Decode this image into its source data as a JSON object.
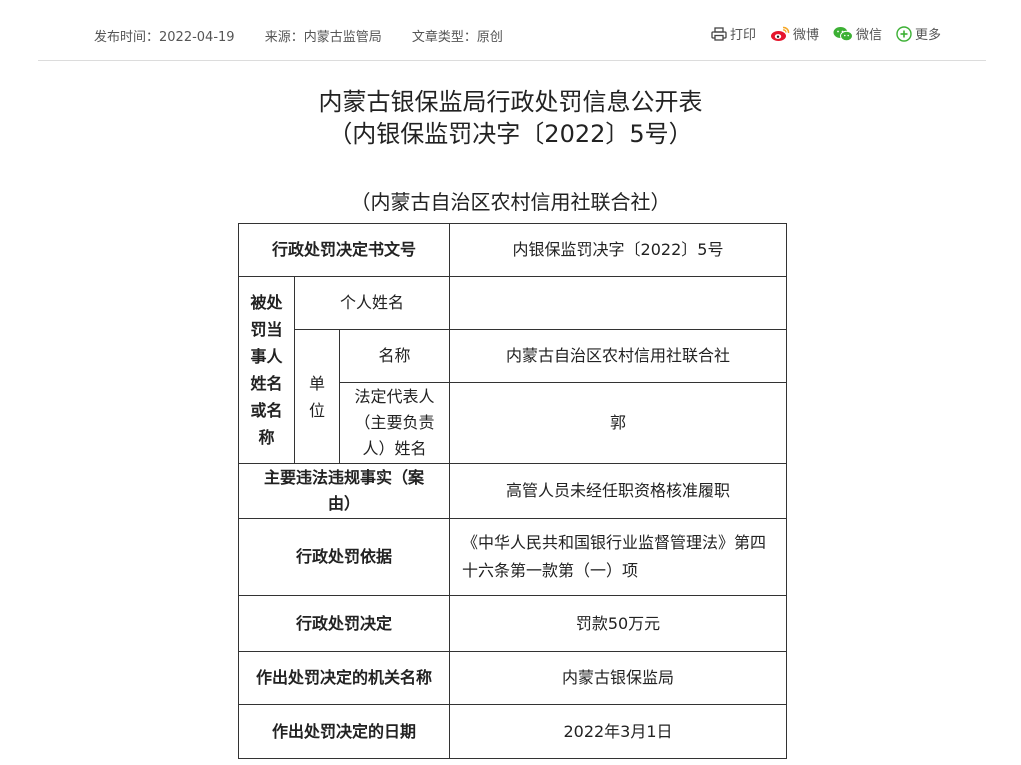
{
  "meta": {
    "publish_time": "发布时间：2022-04-19",
    "source": "来源：内蒙古监管局",
    "article_type": "文章类型：原创"
  },
  "share": {
    "print": "打印",
    "weibo": "微博",
    "wechat": "微信",
    "more": "更多"
  },
  "title_line1": "内蒙古银保监局行政处罚信息公开表",
  "title_line2": "（内银保监罚决字〔2022〕5号）",
  "subtitle": "（内蒙古自治区农村信用社联合社）",
  "table": {
    "doc_no_label": "行政处罚决定书文号",
    "doc_no_value": "内银保监罚决字〔2022〕5号",
    "party_label": "被处罚当事人姓名或名称",
    "person_name_label": "个人姓名",
    "person_name_value": "",
    "unit_label": "单位",
    "unit_name_label": "名称",
    "unit_name_value": "内蒙古自治区农村信用社联合社",
    "legal_rep_label": "法定代表人（主要负责人）姓名",
    "legal_rep_value": "郭",
    "violation_label": "主要违法违规事实（案由）",
    "violation_value": "高管人员未经任职资格核准履职",
    "basis_label": "行政处罚依据",
    "basis_value": "《中华人民共和国银行业监督管理法》第四十六条第一款第（一）项",
    "decision_label": "行政处罚决定",
    "decision_value": "罚款50万元",
    "authority_label": "作出处罚决定的机关名称",
    "authority_value": "内蒙古银保监局",
    "date_label": "作出处罚决定的日期",
    "date_value": "2022年3月1日"
  }
}
